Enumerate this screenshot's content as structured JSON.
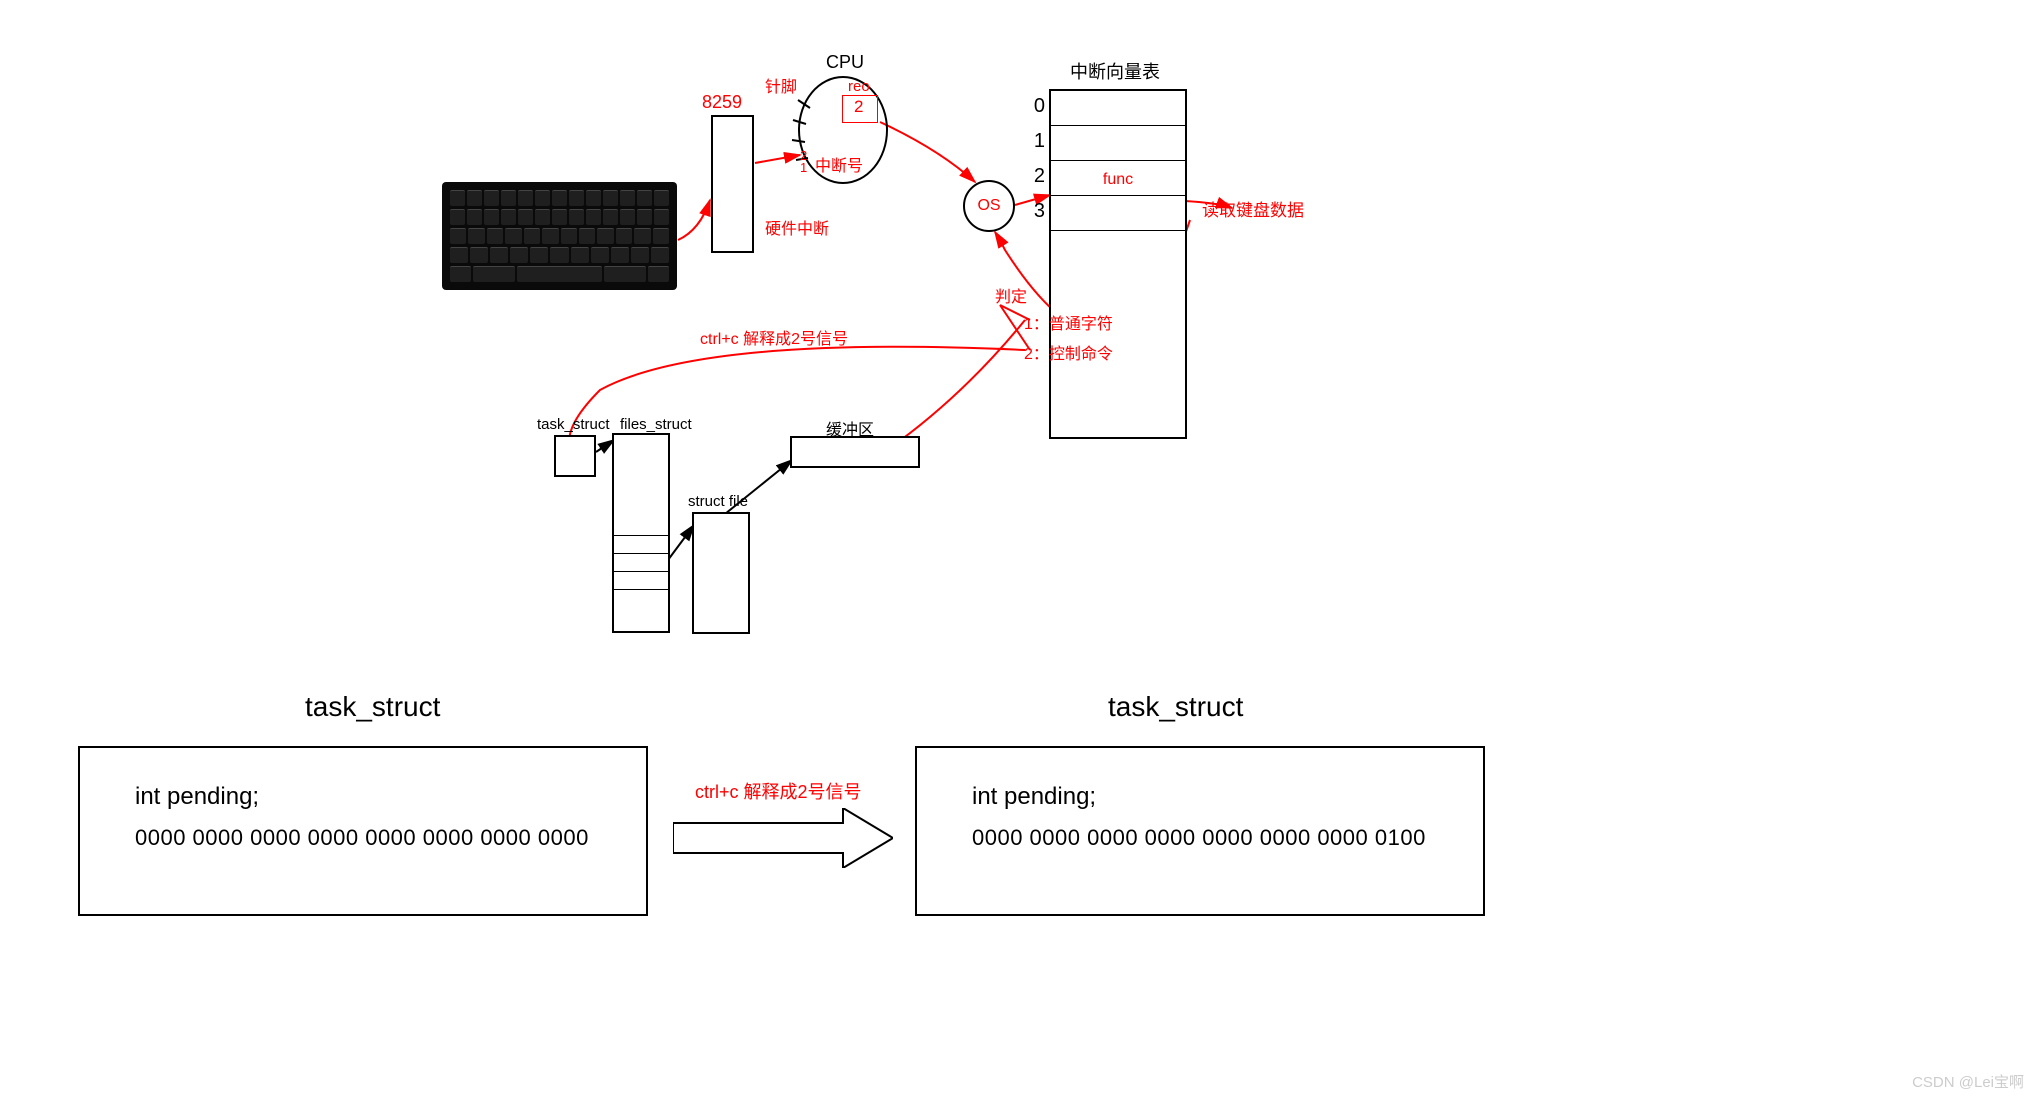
{
  "labels": {
    "cpu": "CPU",
    "pin": "针脚",
    "chip": "8259",
    "reo": "reo",
    "reo_val": "2",
    "int_no": "中断号",
    "int_no_vals": "2\n1",
    "hw_int": "硬件中断",
    "os": "OS",
    "ivt_title": "中断向量表",
    "ivt_idx": [
      "0",
      "1",
      "2",
      "3"
    ],
    "func": "func",
    "read_kbd": "读取键盘数据",
    "judge": "判定",
    "opt1": "1：普通字符",
    "opt2": "2：控制命令",
    "ctrlc": "ctrl+c 解释成2号信号",
    "task_struct_s": "task_struct",
    "files_struct": "files_struct",
    "struct_file": "struct file",
    "buffer": "缓冲区",
    "task_struct_b": "task_struct",
    "pending": "int pending;",
    "bits0": "0000 0000 0000 0000 0000 0000 0000 0000",
    "bits1": "0000 0000 0000 0000 0000 0000 0000  0100",
    "ctrlc2": "ctrl+c 解释成2号信号",
    "watermark": "CSDN @Lei宝啊"
  }
}
